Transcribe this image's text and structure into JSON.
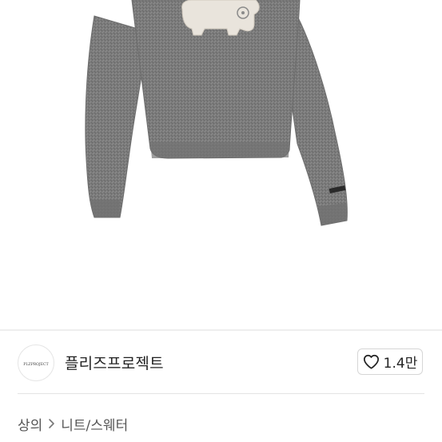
{
  "product": {
    "image_icon": "sweater-photo",
    "logo_text": "PLZPROJECT"
  },
  "brand": {
    "name": "플리즈프로젝트",
    "logo_icon": "brand-logo"
  },
  "like": {
    "icon": "heart-outline-icon",
    "count": "1.4만"
  },
  "breadcrumb": {
    "items": [
      "상의",
      "니트/스웨터"
    ],
    "separator_icon": "chevron-right-icon"
  },
  "colors": {
    "sweater": "#7a7a7a",
    "text_primary": "#222222",
    "text_secondary": "#555555",
    "border": "#d6d6d6"
  }
}
